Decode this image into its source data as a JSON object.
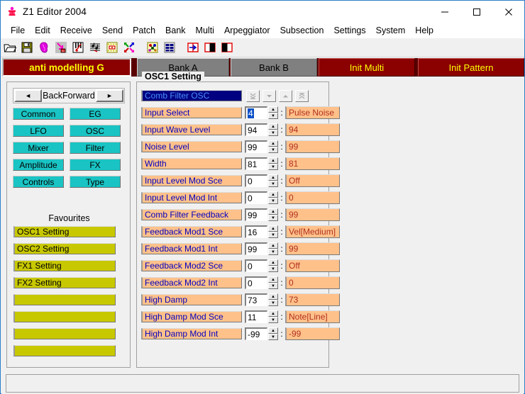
{
  "window": {
    "title": "Z1 Editor 2004",
    "icon": "app-figure-icon",
    "caption": {
      "minimize": "minimize-icon",
      "maximize": "maximize-icon",
      "close": "close-icon"
    }
  },
  "menu": {
    "items": [
      "File",
      "Edit",
      "Receive",
      "Send",
      "Patch",
      "Bank",
      "Multi",
      "Arpeggiator",
      "Subsection",
      "Settings",
      "System",
      "Help"
    ]
  },
  "toolbar": {
    "buttons": [
      {
        "name": "open-folder-icon"
      },
      {
        "name": "save-disk-icon"
      },
      {
        "name": "brain-receive-icon"
      },
      {
        "name": "send-arrow-icon"
      },
      {
        "name": "keyboard-patch-icon"
      },
      {
        "name": "staff-notes-icon"
      },
      {
        "name": "bank-grid-icon"
      },
      {
        "name": "multi-arrows-icon"
      },
      {
        "sep": true
      },
      {
        "name": "arpeggiator-icon"
      },
      {
        "name": "subsection-grid-icon"
      },
      {
        "sep": true
      },
      {
        "name": "compare-icon"
      },
      {
        "name": "split-left-icon"
      },
      {
        "name": "split-right-icon"
      }
    ]
  },
  "tabs": [
    {
      "label": "anti modelling G",
      "state": "selected"
    },
    {
      "label": "Bank A",
      "state": "gray"
    },
    {
      "label": "Bank B",
      "state": "gray"
    },
    {
      "label": "Init Multi",
      "state": "red"
    },
    {
      "label": "Init Pattern",
      "state": "red"
    }
  ],
  "sidebar": {
    "nav": {
      "back_arrow": "◄",
      "back_label": "Back",
      "forward_label": "Forward",
      "forward_arrow": "►"
    },
    "section_buttons": [
      "Common",
      "EG",
      "LFO",
      "OSC",
      "Mixer",
      "Filter",
      "Amplitude",
      "FX",
      "Controls",
      "Type"
    ],
    "favourites_title": "Favourites",
    "favourites": [
      "OSC1 Setting",
      "OSC2 Setting",
      "FX1 Setting",
      "FX2 Setting",
      "",
      "",
      "",
      ""
    ]
  },
  "panel": {
    "title": "OSC1 Setting",
    "selector": "Comb Filter OSC",
    "nav_buttons": [
      "double-down-icon",
      "down-icon",
      "up-icon",
      "double-up-icon"
    ],
    "separator": ":",
    "rows": [
      {
        "label": "Input Select",
        "input": "4",
        "value": "Pulse Noise",
        "selected": true
      },
      {
        "label": "Input Wave Level",
        "input": "94",
        "value": "94",
        "selected": false
      },
      {
        "label": "Noise Level",
        "input": "99",
        "value": "99",
        "selected": false
      },
      {
        "label": "Width",
        "input": "81",
        "value": "81",
        "selected": false
      },
      {
        "label": "Input Level Mod Sce",
        "input": "0",
        "value": "Off",
        "selected": false
      },
      {
        "label": "Input Level Mod Int",
        "input": "0",
        "value": "0",
        "selected": false
      },
      {
        "label": "Comb Filter Feedback",
        "input": "99",
        "value": "99",
        "selected": false
      },
      {
        "label": "Feedback Mod1 Sce",
        "input": "16",
        "value": "Vel[Medium]",
        "selected": false
      },
      {
        "label": "Feedback Mod1 Int",
        "input": "99",
        "value": "99",
        "selected": false
      },
      {
        "label": "Feedback Mod2 Sce",
        "input": "0",
        "value": "Off",
        "selected": false
      },
      {
        "label": "Feedback Mod2 Int",
        "input": "0",
        "value": "0",
        "selected": false
      },
      {
        "label": "High Damp",
        "input": "73",
        "value": "73",
        "selected": false
      },
      {
        "label": "High Damp Mod Sce",
        "input": "11",
        "value": "Note[Line]",
        "selected": false
      },
      {
        "label": "High Damp Mod Int",
        "input": "-99",
        "value": "-99",
        "selected": false
      }
    ]
  },
  "statusbar": {
    "text": ""
  },
  "colors": {
    "tab_selected_bg": "#8b0000",
    "tab_selected_fg": "#ffff00",
    "tab_gray_bg": "#808080",
    "cyan_button": "#1ac4c4",
    "favourite_button": "#c8c800",
    "param_label_bg": "#ffc18a",
    "param_label_fg": "#0000c0",
    "param_value_fg": "#b03020",
    "selector_bg": "#000080",
    "window_border": "#2a7fc9"
  }
}
